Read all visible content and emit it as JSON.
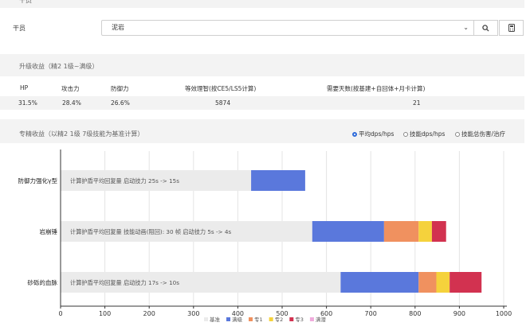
{
  "top_section": {
    "title": "干员"
  },
  "operator": {
    "label": "干员",
    "selected": "泥岩"
  },
  "upgrade": {
    "title": "升级收益（精2 1级~满级）",
    "headers": [
      "HP",
      "攻击力",
      "防御力",
      "等效理智(按CE5/LS5计算)",
      "需要天数(按基建+自回体+月卡计算)"
    ],
    "values": [
      "31.5%",
      "28.4%",
      "26.6%",
      "5874",
      "21"
    ]
  },
  "mastery": {
    "title": "专精收益（以精2 1级 7级技能为基准计算）",
    "options": [
      {
        "label": "平均dps/hps",
        "selected": true
      },
      {
        "label": "技能dps/hps",
        "selected": false
      },
      {
        "label": "技能总伤害/治疗",
        "selected": false
      }
    ]
  },
  "colors": {
    "base": "#ebebeb",
    "manji": "#5a78dc",
    "m1": "#f0915f",
    "m2": "#f5d23c",
    "m3": "#d23250",
    "full": "#f0aadc"
  },
  "chart_data": {
    "type": "bar",
    "orientation": "horizontal",
    "stacked": true,
    "xlim": [
      0,
      1000
    ],
    "xticks": [
      0,
      100,
      200,
      300,
      400,
      500,
      600,
      700,
      800,
      900,
      1000
    ],
    "categories": [
      "防御力强化γ型",
      "岩崩锤",
      "砂砾的血脉"
    ],
    "annotations": [
      "计算护盾平均回复量 启动技力 25s -> 15s",
      "计算护盾平均回复量 技能动画(阻回): 30 帧 启动技力 5s -> 4s",
      "计算护盾平均回复量 启动技力 17s -> 10s"
    ],
    "series": [
      {
        "name": "基准",
        "values": [
          430,
          568,
          632
        ]
      },
      {
        "name": "满级",
        "values": [
          122,
          162,
          176
        ]
      },
      {
        "name": "专1",
        "values": [
          0,
          78,
          40
        ]
      },
      {
        "name": "专2",
        "values": [
          0,
          30,
          30
        ]
      },
      {
        "name": "专3",
        "values": [
          0,
          32,
          72
        ]
      },
      {
        "name": "满潜",
        "values": [
          0,
          0,
          0
        ]
      }
    ]
  }
}
